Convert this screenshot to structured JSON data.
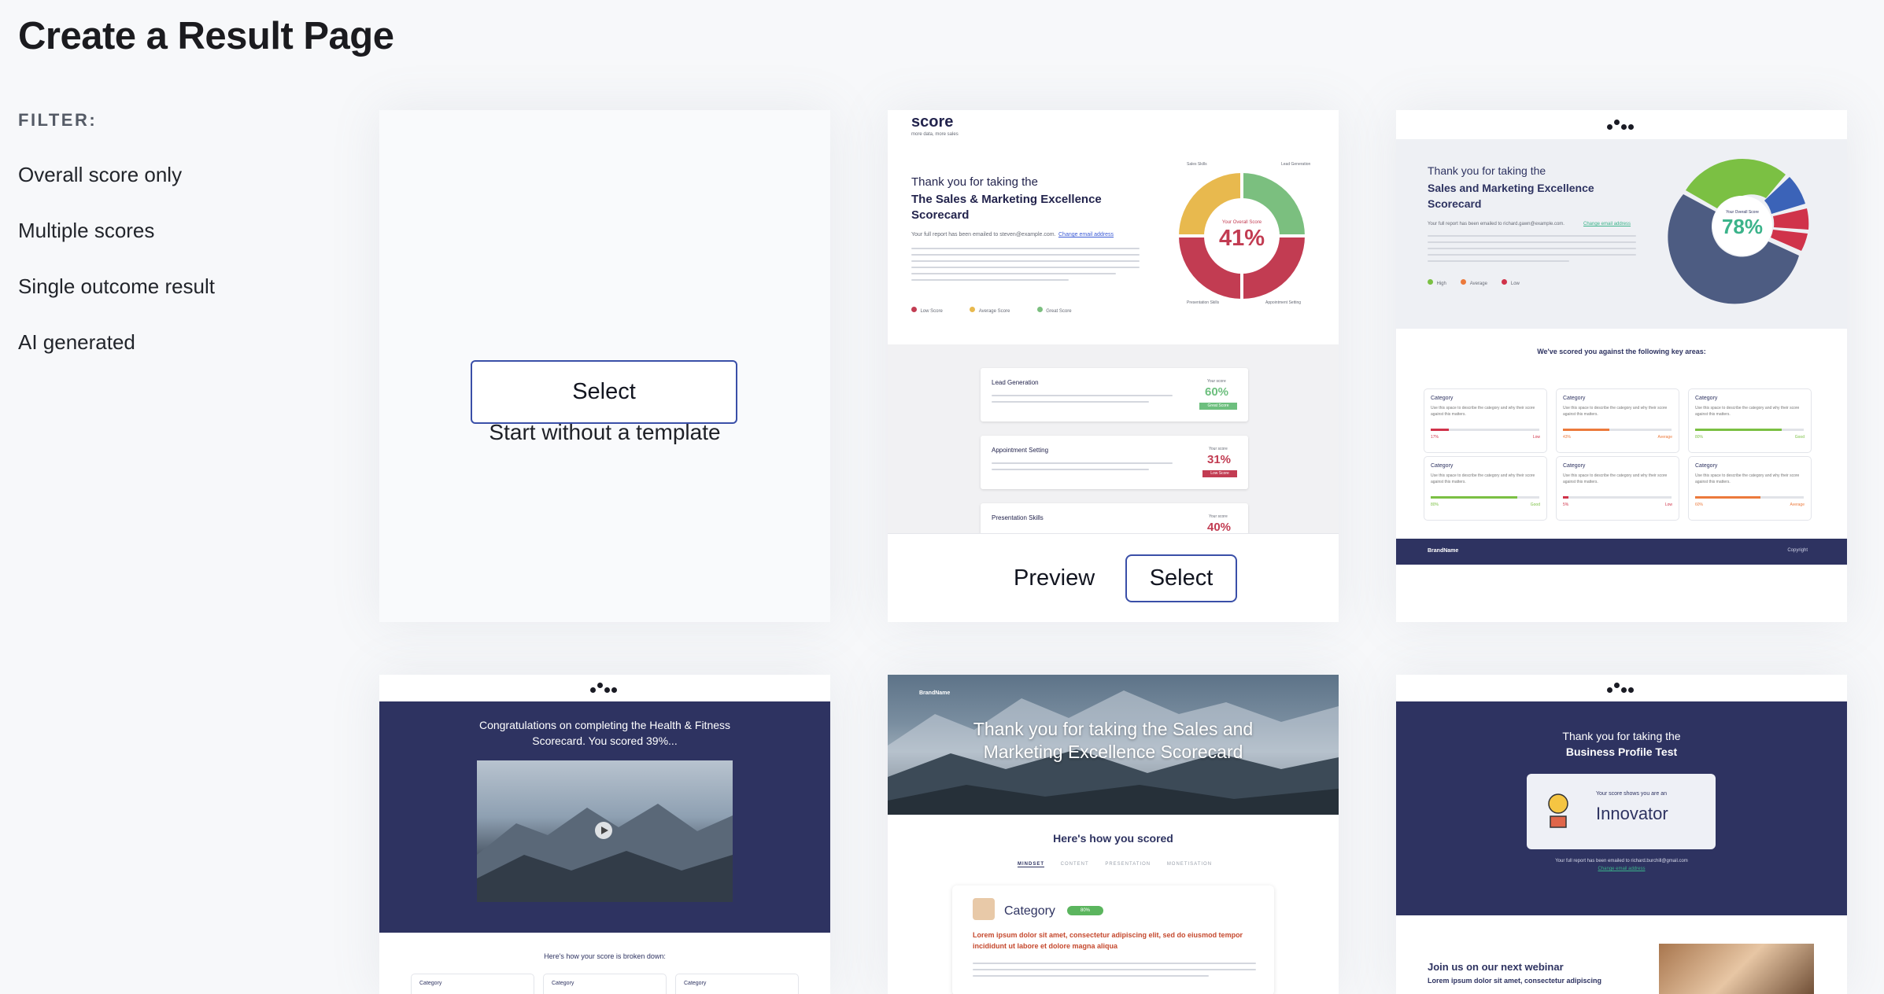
{
  "page": {
    "title": "Create a Result Page"
  },
  "filter": {
    "label": "FILTER:",
    "items": [
      "Overall score only",
      "Multiple scores",
      "Single outcome result",
      "AI generated"
    ]
  },
  "cards": {
    "blank": {
      "title": "Start without a template",
      "select_label": "Select"
    },
    "card1": {
      "logo": "score",
      "tagline": "more data, more sales",
      "heading_line1": "Thank you for taking the",
      "heading_line2": "The Sales & Marketing Excellence Scorecard",
      "email_line": "Your full report has been emailed to steven@example.com.",
      "email_link": "Change email address",
      "donut_center_label": "Your Overall Score",
      "donut_value": "41%",
      "segments": [
        "Sales Skills",
        "Lead Generation",
        "Presentation Skills",
        "Appointment Setting"
      ],
      "legend": [
        "Low Score",
        "Average Score",
        "Great Score"
      ],
      "rows": [
        {
          "title": "Lead Generation",
          "score_label": "Your score",
          "score": "60%",
          "badge": "Great Score"
        },
        {
          "title": "Appointment Setting",
          "score_label": "Your score",
          "score": "31%",
          "badge": "Low Score"
        },
        {
          "title": "Presentation Skills",
          "score_label": "Your score",
          "score": "40%"
        }
      ],
      "preview_label": "Preview",
      "select_label": "Select"
    },
    "card2": {
      "heading_line1": "Thank you for taking the",
      "heading_line2": "Sales and Marketing Excellence Scorecard",
      "email_line": "Your full report has been emailed to richard.gawn@example.com.",
      "email_link": "Change email address",
      "donut_center_label": "Your Overall Score",
      "donut_value": "78%",
      "legend": [
        "High",
        "Average",
        "Low"
      ],
      "section_title": "We've scored you against the following key areas:",
      "category_label": "Category",
      "category_desc": "Use this space to describe the category and why their score against this matters.",
      "categories": [
        {
          "pct": "17%",
          "level": "Low",
          "color": "#d0334a",
          "fill": 0.17
        },
        {
          "pct": "43%",
          "level": "Average",
          "color": "#ec7a3c",
          "fill": 0.43
        },
        {
          "pct": "80%",
          "level": "Good",
          "color": "#7bc043",
          "fill": 0.8
        },
        {
          "pct": "80%",
          "level": "Good",
          "color": "#7bc043",
          "fill": 0.8
        },
        {
          "pct": "5%",
          "level": "Low",
          "color": "#d0334a",
          "fill": 0.05
        },
        {
          "pct": "60%",
          "level": "Average",
          "color": "#ec7a3c",
          "fill": 0.6
        }
      ],
      "footer_brand": "BrandName",
      "footer_copy": "Copyright"
    },
    "card3": {
      "heading": "Congratulations on completing the Health & Fitness Scorecard. You scored 39%...",
      "breakdown_title": "Here's how your score is broken down:",
      "category_label": "Category"
    },
    "card4": {
      "brand": "BrandName",
      "hero_title": "Thank you for taking the Sales and Marketing Excellence Scorecard",
      "subtitle": "Here's how you scored",
      "tabs": [
        "MINDSET",
        "CONTENT",
        "PRESENTATION",
        "MONETISATION"
      ],
      "category_label": "Category",
      "category_badge": "80%",
      "body_bold": "Lorem ipsum dolor sit amet, consectetur adipiscing elit, sed do eiusmod tempor incididunt ut labore et dolore magna aliqua"
    },
    "card5": {
      "heading_line1": "Thank you for taking the",
      "heading_line2": "Business Profile Test",
      "result_label": "Your score shows you are an",
      "result_value": "Innovator",
      "email_line": "Your full report has been emailed to richard.burchill@gmail.com",
      "email_link": "Change email address",
      "webinar_title": "Join us on our next webinar",
      "webinar_text": "Lorem ipsum dolor sit amet, consectetur adipiscing"
    }
  },
  "colors": {
    "navy": "#2e3361",
    "accent_border": "#3a4fa8",
    "low": "#d0334a",
    "average": "#ec7a3c",
    "good": "#7bc043",
    "great": "#6dbf7e"
  }
}
